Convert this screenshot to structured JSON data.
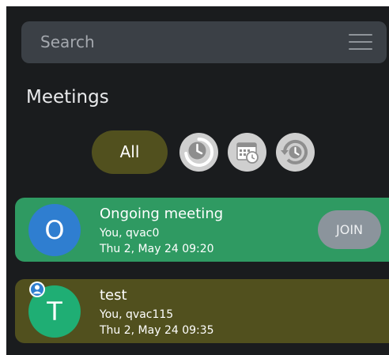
{
  "search": {
    "placeholder": "Search",
    "menu_icon": "hamburger-menu-icon"
  },
  "section": {
    "title": "Meetings"
  },
  "filters": {
    "all_label": "All",
    "icons": [
      "recent-clock-icon",
      "scheduled-calendar-icon",
      "history-icon"
    ]
  },
  "meetings": [
    {
      "avatar_letter": "O",
      "title": "Ongoing meeting",
      "participants": "You, qvac0",
      "datetime": "Thu 2, May 24 09:20",
      "action_label": "JOIN",
      "card_color": "#2f9a62",
      "avatar_color": "#2f7ed0"
    },
    {
      "avatar_letter": "T",
      "title": "test",
      "participants": "You, qvac115",
      "datetime": "Thu 2, May 24 09:35",
      "badge_icon": "user-badge-icon",
      "card_color": "#51501e",
      "avatar_color": "#1fae74"
    }
  ],
  "colors": {
    "background": "#1a1c1e",
    "search_bar": "#3b4046",
    "filter_active": "#51501e",
    "join_button": "#8b949c"
  }
}
